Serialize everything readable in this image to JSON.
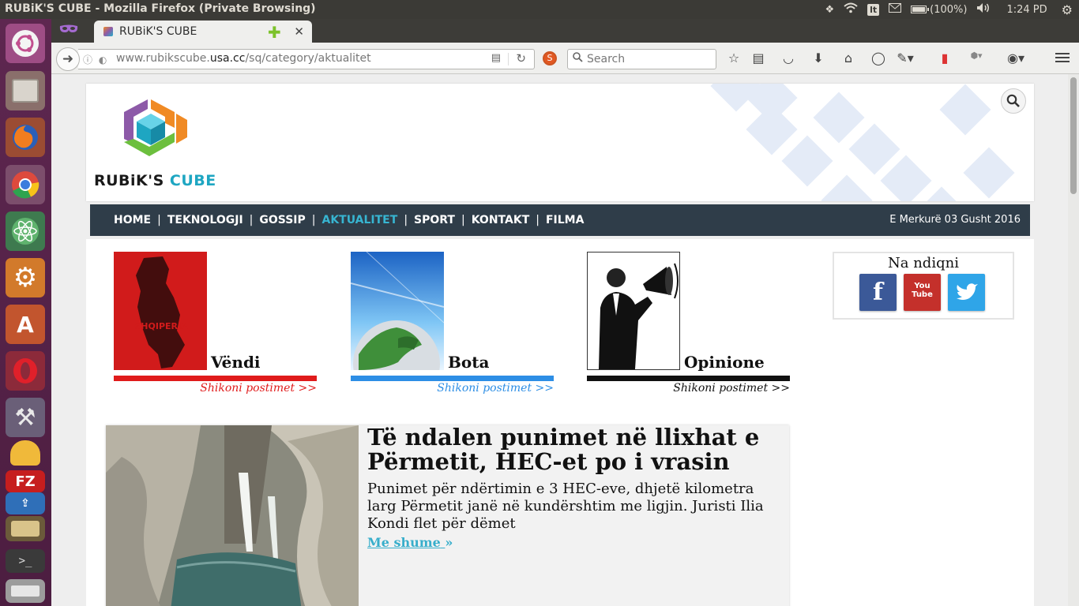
{
  "system": {
    "window_title": "RUBiK'S CUBE - Mozilla Firefox (Private Browsing)",
    "keyboard_layout": "lt",
    "battery": "(100%)",
    "battery_level": 1.0,
    "clock": "1:24 PD"
  },
  "launcher": {
    "apps": [
      "ubuntu-dash",
      "files",
      "firefox",
      "chrome",
      "atom",
      "system-settings",
      "software-center",
      "opera",
      "tools",
      "disk-usage",
      "filezilla",
      "software-updater",
      "archive",
      "terminal",
      "scanner"
    ]
  },
  "browser": {
    "tab_title": "RUBiK'S CUBE",
    "url_prefix": "www.rubikscube.",
    "url_domain": "usa.cc",
    "url_path": "/sq/category/aktualitet",
    "search_placeholder": "Search"
  },
  "site": {
    "logo_text_1": "RUBiK'S",
    "logo_text_2": "CUBE",
    "nav": [
      {
        "label": "HOME",
        "active": false
      },
      {
        "label": "TEKNOLOGJI",
        "active": false
      },
      {
        "label": "GOSSIP",
        "active": false
      },
      {
        "label": "AKTUALITET",
        "active": true
      },
      {
        "label": "SPORT",
        "active": false
      },
      {
        "label": "KONTAKT",
        "active": false
      },
      {
        "label": "FILMA",
        "active": false
      }
    ],
    "nav_separator": "|",
    "date": "E Merkurë 03 Gusht 2016",
    "categories": [
      {
        "title": "Vëndi",
        "link": "Shikoni postimet >>",
        "color": "#e01b1b",
        "map_word": "SHQIPERIA"
      },
      {
        "title": "Bota",
        "link": "Shikoni postimet >>",
        "color": "#2d8ee5"
      },
      {
        "title": "Opinione",
        "link": "Shikoni postimet >>",
        "color": "#111111"
      }
    ],
    "follow": {
      "title": "Na ndiqni",
      "networks": [
        "facebook",
        "youtube",
        "twitter"
      ],
      "youtube_label": "You Tube"
    },
    "article": {
      "title": "Të ndalen punimet në llixhat e Përmetit, HEC-et po i vrasin",
      "text": "Punimet për ndërtimin e 3 HEC-eve, dhjetë kilometra larg Përmetit janë në kundërshtim me ligjin. Juristi Ilia Kondi flet për dëmet",
      "more": "Me shume"
    }
  },
  "colors": {
    "accent": "#37b5d1",
    "nav_bg": "#2f3d49",
    "launcher_bg": "#5e2750"
  }
}
